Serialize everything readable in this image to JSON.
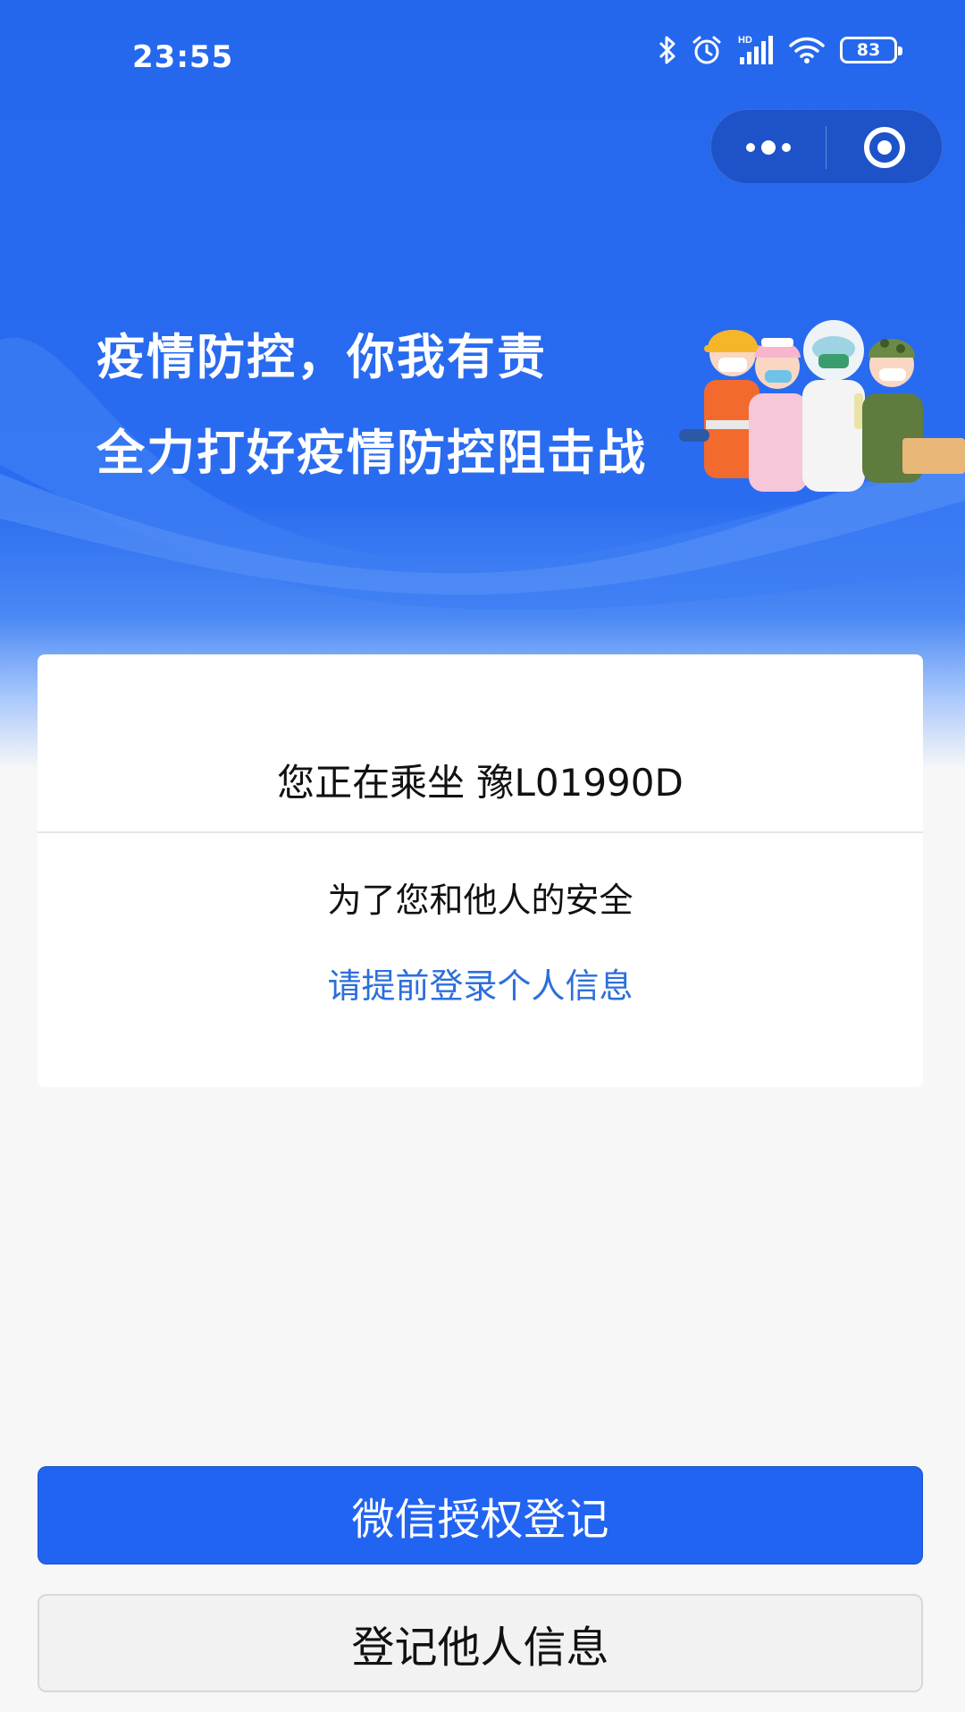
{
  "status_bar": {
    "time": "23:55",
    "network_label": "HD",
    "battery": "83",
    "icons": [
      "bluetooth-icon",
      "alarm-icon",
      "signal-icon",
      "wifi-icon",
      "battery-icon"
    ]
  },
  "capsule": {
    "icons": [
      "more-icon",
      "close-target-icon"
    ]
  },
  "banner": {
    "slogan_line1": "疫情防控，你我有责",
    "slogan_line2": "全力打好疫情防控阻击战"
  },
  "card": {
    "riding_text": "您正在乘坐 豫L01990D",
    "safety_text": "为了您和他人的安全",
    "login_hint": "请提前登录个人信息"
  },
  "buttons": {
    "wechat_auth": "微信授权登记",
    "register_others": "登记他人信息"
  },
  "colors": {
    "primary_blue": "#2164f2",
    "header_blue": "#2467ee",
    "link_blue": "#2c6fdc",
    "background": "#f7f7f7"
  }
}
